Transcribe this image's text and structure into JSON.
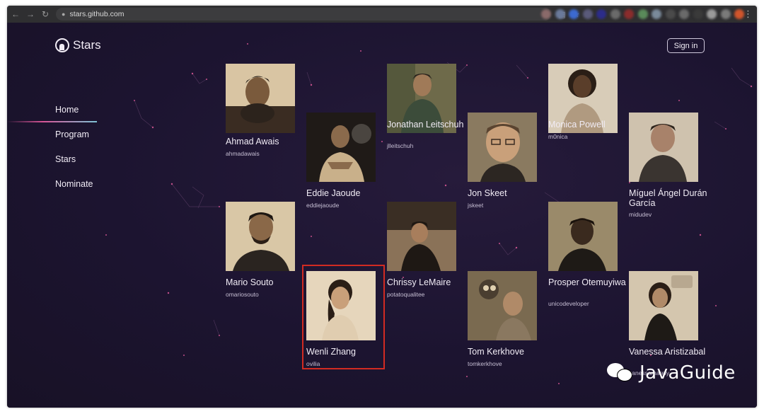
{
  "browser": {
    "url": "stars.github.com",
    "back_icon": "arrow-left-icon",
    "forward_icon": "arrow-right-icon",
    "reload_icon": "reload-icon"
  },
  "site": {
    "logo_text": "Stars",
    "sign_in_label": "Sign in"
  },
  "nav": {
    "items": [
      {
        "label": "Home",
        "active": true
      },
      {
        "label": "Program",
        "active": false
      },
      {
        "label": "Stars",
        "active": false
      },
      {
        "label": "Nominate",
        "active": false
      }
    ]
  },
  "stars": [
    {
      "name": "Ahmad Awais",
      "handle": "ahmadawais"
    },
    {
      "name": "Eddie Jaoude",
      "handle": "eddiejaoude"
    },
    {
      "name": "Jonathan Leitschuh",
      "handle": "jlleitschuh"
    },
    {
      "name": "Jon Skeet",
      "handle": "jskeet"
    },
    {
      "name": "Monica Powell",
      "handle": "m0nica"
    },
    {
      "name": "Míguel Ángel Durán García",
      "handle": "midudev"
    },
    {
      "name": "Mario Souto",
      "handle": "omariosouto"
    },
    {
      "name": "Wenli Zhang",
      "handle": "ovilia",
      "highlighted": true
    },
    {
      "name": "Chrissy LeMaire",
      "handle": "potatoqualitee"
    },
    {
      "name": "Tom Kerkhove",
      "handle": "tomkerkhove"
    },
    {
      "name": "Prosper Otemuyiwa",
      "handle": "unicodeveloper"
    },
    {
      "name": "Vanessa Aristizabal",
      "handle": "vanessamarely"
    }
  ],
  "watermark": {
    "text": "JavaGuide"
  },
  "colors": {
    "page_bg": "#1e1530",
    "highlight": "#d22b22",
    "accent_pink": "#d65496",
    "accent_teal": "#7fc4d6"
  }
}
